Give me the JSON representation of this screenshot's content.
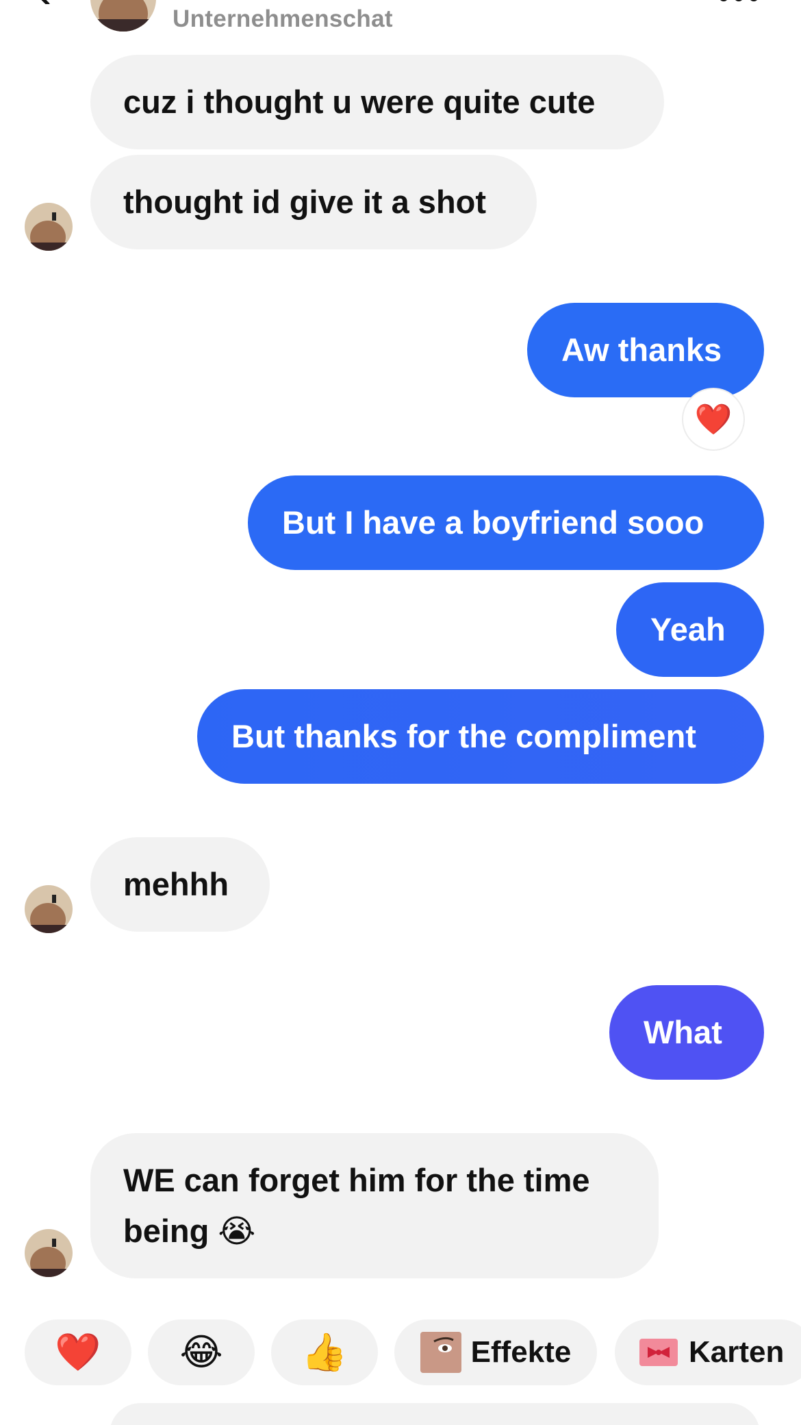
{
  "header": {
    "subtitle": "Unternehmenschat"
  },
  "messages": [
    {
      "side": "in",
      "text": "cuz i thought u were quite cute"
    },
    {
      "side": "in",
      "text": "thought id give it a shot"
    },
    {
      "side": "out",
      "text": "Aw thanks",
      "reaction": "❤️"
    },
    {
      "side": "out",
      "text": "But I have a boyfriend sooo"
    },
    {
      "side": "out",
      "text": "Yeah"
    },
    {
      "side": "out",
      "text": "But thanks for the compliment"
    },
    {
      "side": "in",
      "text": "mehhh"
    },
    {
      "side": "out",
      "text": "What"
    },
    {
      "side": "in",
      "text": "WE can forget him for the time being 😭"
    }
  ],
  "quick_reactions": [
    {
      "emoji": "❤️"
    },
    {
      "emoji": "😂"
    },
    {
      "emoji": "👍"
    },
    {
      "label": "Effekte"
    },
    {
      "label": "Karten"
    }
  ],
  "colors": {
    "incoming_bubble": "#f2f2f2",
    "outgoing_blue": "#2a6cf5",
    "outgoing_violet": "#4f52f3",
    "subtitle_gray": "#8e8e8e"
  }
}
